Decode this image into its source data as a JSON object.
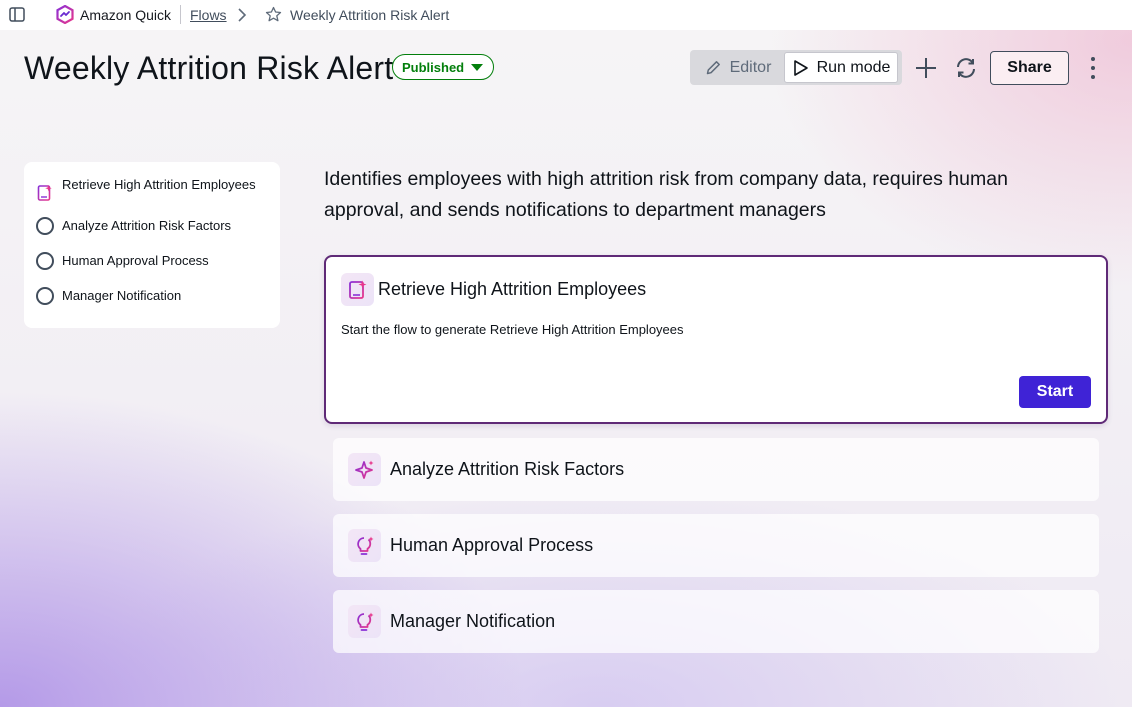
{
  "app": {
    "name": "Amazon Quick",
    "breadcrumb_flows": "Flows",
    "breadcrumb_current": "Weekly Attrition Risk Alert"
  },
  "header": {
    "title": "Weekly Attrition Risk Alert",
    "status": "Published",
    "editor_label": "Editor",
    "run_mode_label": "Run mode",
    "share_label": "Share"
  },
  "steps": [
    {
      "label": "Retrieve High Attrition Employees",
      "icon": "agent-document-icon",
      "active": true
    },
    {
      "label": "Analyze Attrition Risk Factors",
      "icon": "circle-outline-icon",
      "active": false
    },
    {
      "label": "Human Approval Process",
      "icon": "circle-outline-icon",
      "active": false
    },
    {
      "label": "Manager Notification",
      "icon": "circle-outline-icon",
      "active": false
    }
  ],
  "main": {
    "description": "Identifies employees with high attrition risk from company data, requires human approval, and sends notifications to department managers",
    "active_card": {
      "title": "Retrieve High Attrition Employees",
      "text": "Start the flow to generate Retrieve High Attrition Employees",
      "button": "Start",
      "icon": "agent-document-icon"
    },
    "cards": [
      {
        "title": "Analyze Attrition Risk Factors",
        "icon": "sparkle-icon"
      },
      {
        "title": "Human Approval Process",
        "icon": "lightbulb-icon"
      },
      {
        "title": "Manager Notification",
        "icon": "lightbulb-icon"
      }
    ]
  },
  "colors": {
    "accent": "#3f23d6",
    "published": "#037f0c",
    "card_border": "#5f2a77",
    "icon_gradient_start": "#8a2fd6",
    "icon_gradient_end": "#e8378b"
  }
}
